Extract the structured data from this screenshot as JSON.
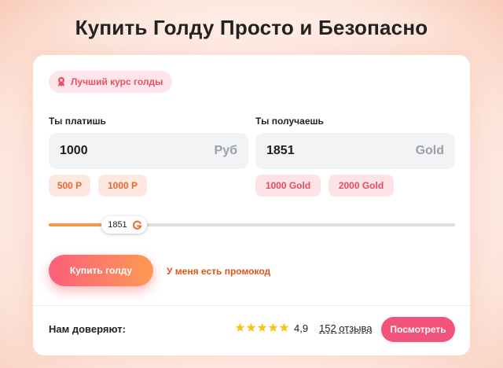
{
  "page": {
    "title": "Купить Голду Просто и Безопасно"
  },
  "badge": {
    "label": "Лучший курс голды",
    "icon": "award-ribbon-icon"
  },
  "pay": {
    "label": "Ты платишь",
    "value": "1000",
    "unit": "Руб",
    "presets": [
      "500 Р",
      "1000 Р"
    ]
  },
  "receive": {
    "label": "Ты получаешь",
    "value": "1851",
    "unit": "Gold",
    "presets": [
      "1000 Gold",
      "2000 Gold"
    ]
  },
  "slider": {
    "value_label": "1851",
    "icon": "gold-g-icon",
    "fraction": 0.13
  },
  "actions": {
    "buy_label": "Купить голду",
    "promo_label": "У меня есть промокод"
  },
  "trust": {
    "label": "Нам доверяют:",
    "stars": 5,
    "rating": "4,9",
    "reviews": "152 отзыва",
    "view_label": "Посмотреть"
  },
  "colors": {
    "accent_pink": "#f2537a",
    "accent_orange": "#f49a4b",
    "star": "#f5c518"
  }
}
